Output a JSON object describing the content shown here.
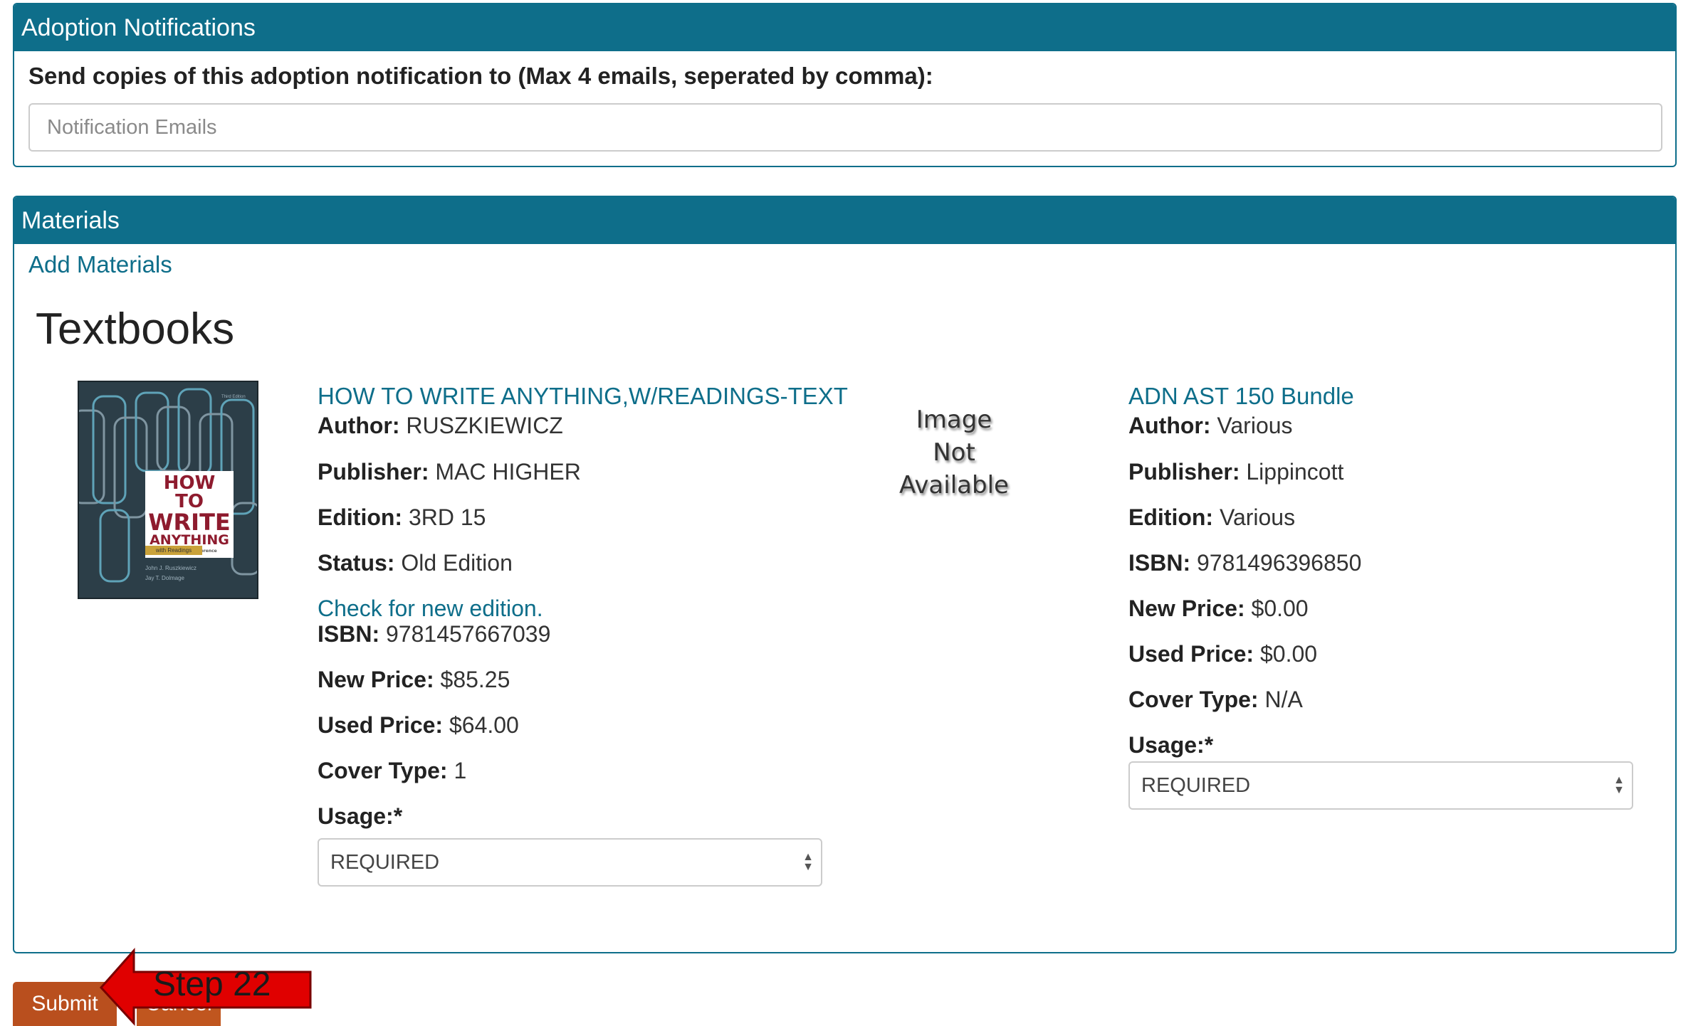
{
  "adoption": {
    "header": "Adoption Notifications",
    "label": "Send copies of this adoption notification to (Max 4 emails, seperated by comma):",
    "email_placeholder": "Notification Emails",
    "email_value": ""
  },
  "materials": {
    "header": "Materials",
    "add_link": "Add Materials",
    "section_title": "Textbooks",
    "items": [
      {
        "title": "HOW TO WRITE ANYTHING,W/READINGS-TEXT",
        "cover": {
          "title_line1": "HOW TO",
          "title_line2": "WRITE",
          "title_line3": "ANYTHING",
          "subtitle": "A Guide and Reference",
          "pill": "with Readings",
          "author1": "John J. Ruszkiewicz",
          "author2": "Jay T. Dolmage",
          "edition_tag": "Third Edition"
        },
        "author_label": "Author:",
        "author": "RUSZKIEWICZ",
        "publisher_label": "Publisher:",
        "publisher": "MAC HIGHER",
        "edition_label": "Edition:",
        "edition": "3RD 15",
        "status_label": "Status:",
        "status": "Old Edition",
        "check_link": "Check for new edition.",
        "isbn_label": "ISBN:",
        "isbn": "9781457667039",
        "new_price_label": "New Price:",
        "new_price": "$85.25",
        "used_price_label": "Used Price:",
        "used_price": "$64.00",
        "cover_type_label": "Cover Type:",
        "cover_type": "1",
        "usage_label": "Usage:",
        "usage_required_mark": "*",
        "usage_value": "REQUIRED"
      },
      {
        "title": "ADN AST 150 Bundle",
        "no_image": [
          "Image",
          "Not",
          "Available"
        ],
        "author_label": "Author:",
        "author": "Various",
        "publisher_label": "Publisher:",
        "publisher": "Lippincott",
        "edition_label": "Edition:",
        "edition": "Various",
        "isbn_label": "ISBN:",
        "isbn": "9781496396850",
        "new_price_label": "New Price:",
        "new_price": "$0.00",
        "used_price_label": "Used Price:",
        "used_price": "$0.00",
        "cover_type_label": "Cover Type:",
        "cover_type": "N/A",
        "usage_label": "Usage:",
        "usage_required_mark": "*",
        "usage_value": "REQUIRED"
      }
    ]
  },
  "actions": {
    "submit_label": "Submit",
    "cancel_label": "Cancel"
  },
  "annotation": {
    "callout_text": "Step 22",
    "color": "#e00000"
  }
}
